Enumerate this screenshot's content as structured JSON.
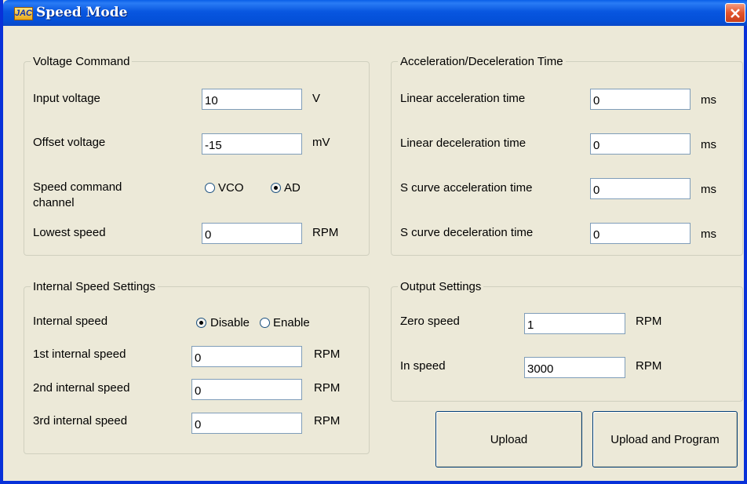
{
  "window": {
    "title": "Speed Mode",
    "app_icon_text": "JAC"
  },
  "voltage_command": {
    "legend": "Voltage Command",
    "input_voltage": {
      "label": "Input voltage",
      "value": "10",
      "unit": "V"
    },
    "offset_voltage": {
      "label": "Offset voltage",
      "value": "-15",
      "unit": "mV"
    },
    "speed_command_channel": {
      "label_line1": "Speed command",
      "label_line2": "channel",
      "options": [
        {
          "label": "VCO",
          "checked": false
        },
        {
          "label": "AD",
          "checked": true
        }
      ]
    },
    "lowest_speed": {
      "label": "Lowest speed",
      "value": "0",
      "unit": "RPM"
    }
  },
  "accel_decel": {
    "legend": "Acceleration/Deceleration Time",
    "rows": [
      {
        "label": "Linear acceleration time",
        "value": "0",
        "unit": "ms"
      },
      {
        "label": "Linear deceleration time",
        "value": "0",
        "unit": "ms"
      },
      {
        "label": "S curve acceleration time",
        "value": "0",
        "unit": "ms"
      },
      {
        "label": "S curve deceleration time",
        "value": "0",
        "unit": "ms"
      }
    ]
  },
  "internal_speed": {
    "legend": "Internal Speed Settings",
    "internal_speed_label": "Internal speed",
    "options": [
      {
        "label": "Disable",
        "checked": true
      },
      {
        "label": "Enable",
        "checked": false
      }
    ],
    "rows": [
      {
        "label": "1st internal speed",
        "value": "0",
        "unit": "RPM"
      },
      {
        "label": "2nd internal speed",
        "value": "0",
        "unit": "RPM"
      },
      {
        "label": "3rd internal speed",
        "value": "0",
        "unit": "RPM"
      }
    ]
  },
  "output_settings": {
    "legend": "Output Settings",
    "zero_speed": {
      "label": "Zero speed",
      "value": "1",
      "unit": "RPM"
    },
    "in_speed": {
      "label": "In speed",
      "value": "3000",
      "unit": "RPM"
    }
  },
  "buttons": {
    "upload": "Upload",
    "upload_and_program": "Upload and Program"
  }
}
